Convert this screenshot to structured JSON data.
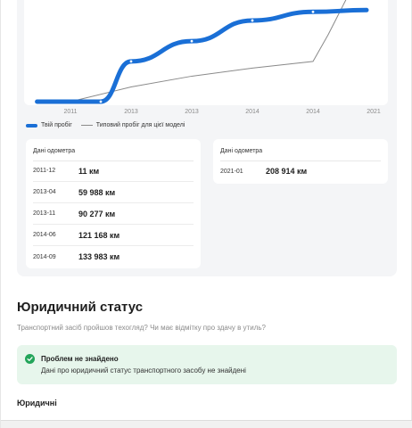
{
  "chart_data": {
    "type": "line",
    "x_tick_labels": [
      "2011",
      "2013",
      "2013",
      "2014",
      "2014",
      "2021"
    ],
    "series": [
      {
        "name": "Твій пробіг",
        "color": "#1a6fd6",
        "points": [
          {
            "x": 0.0,
            "y": 0
          },
          {
            "x": 0.5,
            "y": 11
          },
          {
            "x": 1.0,
            "y": 59988
          },
          {
            "x": 2.0,
            "y": 90277
          },
          {
            "x": 3.0,
            "y": 121168
          },
          {
            "x": 4.0,
            "y": 133983
          }
        ]
      },
      {
        "name": "Типовий пробіг для цієї моделі",
        "color": "#8a8a8a",
        "points": [
          {
            "x": 0.0,
            "y": 0
          },
          {
            "x": 1.0,
            "y": 22000
          },
          {
            "x": 2.0,
            "y": 38000
          },
          {
            "x": 3.0,
            "y": 50000
          },
          {
            "x": 4.0,
            "y": 60000
          },
          {
            "x": 4.25,
            "y": 100000
          },
          {
            "x": 4.7,
            "y": 180000
          }
        ]
      }
    ],
    "ylim": [
      0,
      165000
    ],
    "xlim": [
      -0.55,
      5.0
    ],
    "grid": false,
    "legend_position": "bottom-left"
  },
  "legend": {
    "main_label": "Твій пробіг",
    "typical_label": "Типовий пробіг для цієї моделі"
  },
  "odometer_left": {
    "title": "Дані одометра",
    "rows": [
      {
        "date": "2011-12",
        "value": "11 км"
      },
      {
        "date": "2013-04",
        "value": "59 988 км"
      },
      {
        "date": "2013-11",
        "value": "90 277 км"
      },
      {
        "date": "2014-06",
        "value": "121 168 км"
      },
      {
        "date": "2014-09",
        "value": "133 983 км"
      }
    ]
  },
  "odometer_right": {
    "title": "Дані одометра",
    "rows": [
      {
        "date": "2021-01",
        "value": "208 914 км"
      }
    ]
  },
  "legal": {
    "title": "Юридичний статус",
    "question": "Транспортний засіб пройшов техогляд? Чи має відмітку про здачу в утиль?",
    "status_title": "Проблем не знайдено",
    "status_text": "Дані про юридичний статус транспортного засобу не знайдені",
    "subtitle": "Юридичні"
  },
  "colors": {
    "accent": "#1a6fd6",
    "success_bg": "#e7f6ec",
    "success_icon": "#23a55a"
  }
}
